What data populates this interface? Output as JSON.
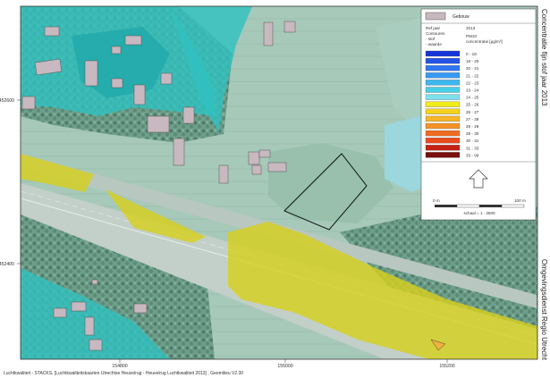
{
  "map": {
    "side_title_top": "Concentratie fijn stof jaar 2013",
    "side_title_bottom": "Omgevingsdienst Regio Utrecht",
    "footer": "Luchtkwaliteit - STACKS, [Luchtkwaliteitskaarten Utrechtse Heuvelrug - Heuvelrug Luchtkwaliteit 2013] , Geomilieu V2.30",
    "y_ticks": [
      "452600",
      "452400"
    ],
    "x_ticks": [
      "154800",
      "155000",
      "155200"
    ]
  },
  "legend": {
    "building_label": "Gebouw",
    "ref_jaar_label": "Ref jaar",
    "ref_jaar_value": "2013",
    "contouren_label": "Contouren",
    "stof_label": "- stof",
    "stof_value": "PM10",
    "waarde_label": "- waarde",
    "waarde_value": "concentratie [µg/m³]",
    "classes": [
      {
        "label": "0 - 18",
        "color": "#1535d8"
      },
      {
        "label": "18 - 20",
        "color": "#2453e6"
      },
      {
        "label": "20 - 21",
        "color": "#2f76f0"
      },
      {
        "label": "21 - 22",
        "color": "#3899f4"
      },
      {
        "label": "22 - 23",
        "color": "#3db7f0"
      },
      {
        "label": "23 - 24",
        "color": "#48cfe6"
      },
      {
        "label": "24 - 25",
        "color": "#7de0ec"
      },
      {
        "label": "25 - 26",
        "color": "#f0ec1a"
      },
      {
        "label": "26 - 27",
        "color": "#f6d21e"
      },
      {
        "label": "27 - 28",
        "color": "#f7b428"
      },
      {
        "label": "28 - 29",
        "color": "#f39228"
      },
      {
        "label": "29 - 30",
        "color": "#ef6c22"
      },
      {
        "label": "30 - 31",
        "color": "#e84a1c"
      },
      {
        "label": "31 - 33",
        "color": "#c52214"
      },
      {
        "label": "33 - 99",
        "color": "#7a0d0d"
      }
    ],
    "scale_left": "0 m",
    "scale_right": "100 m",
    "scale_text": "schaal = 1 : 2500",
    "colors": {
      "building_fill": "#c8b8c0",
      "building_stroke": "#666666"
    }
  },
  "colors": {
    "teal_zone": "#2fc2c0",
    "yellow_zone": "#d7cf1e",
    "background": "#8fb7a8"
  }
}
